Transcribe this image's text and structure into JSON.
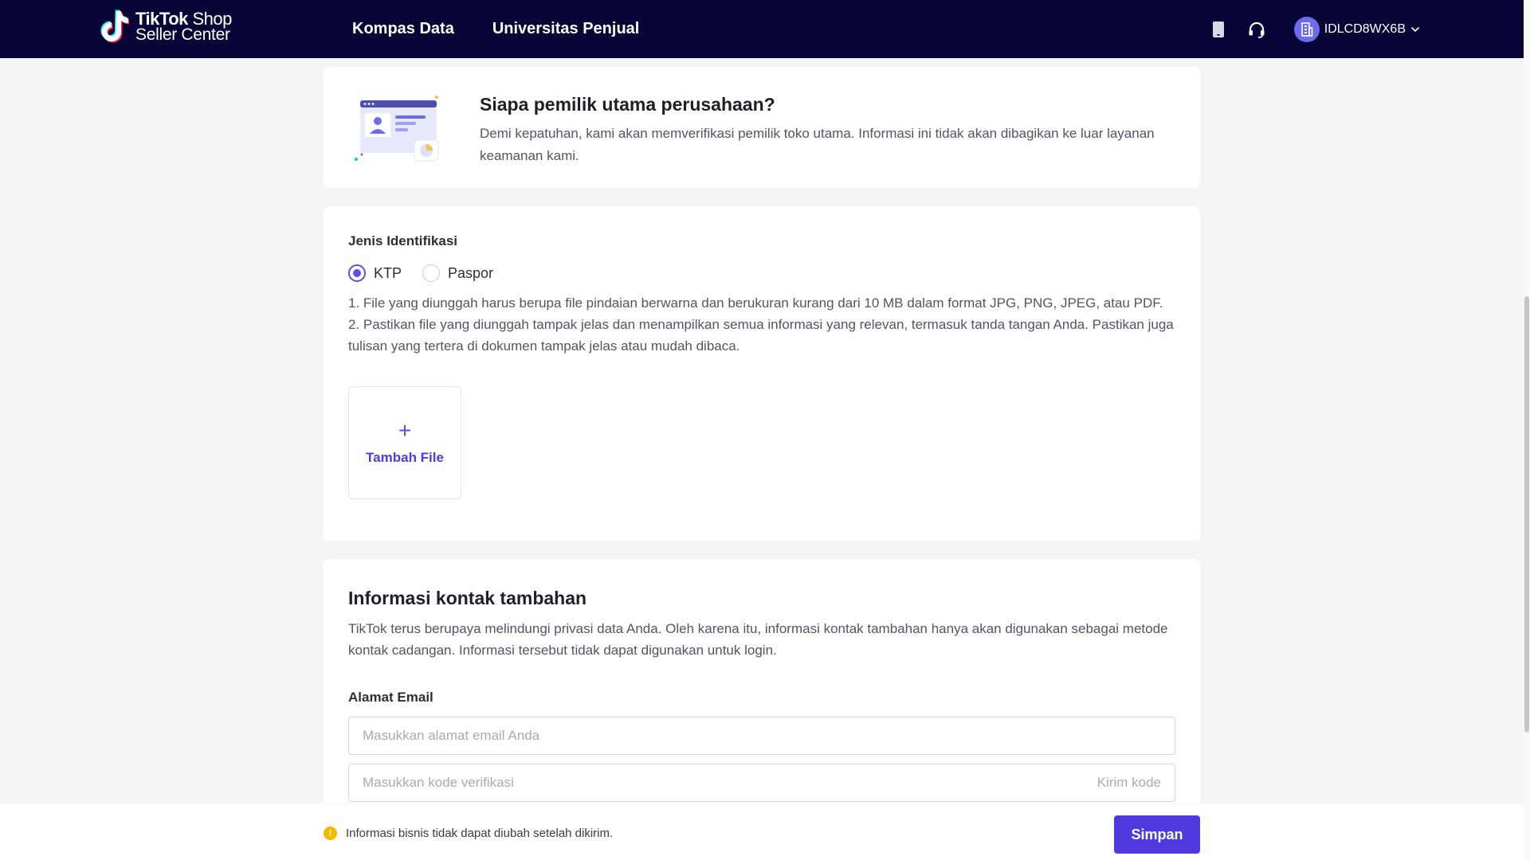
{
  "header": {
    "logo_line1_bold": "TikTok",
    "logo_line1_rest": " Shop",
    "logo_line2": "Seller Center",
    "nav": [
      "Kompas Data",
      "Universitas Penjual"
    ],
    "account_id": "IDLCD8WX6B"
  },
  "owner_section": {
    "title": "Siapa pemilik utama perusahaan?",
    "description": "Demi kepatuhan, kami akan memverifikasi pemilik toko utama. Informasi ini tidak akan dibagikan ke luar layanan keamanan kami."
  },
  "id_section": {
    "label": "Jenis Identifikasi",
    "options": [
      "KTP",
      "Paspor"
    ],
    "selected": "KTP",
    "rule1": "1. File yang diunggah harus berupa file pindaian berwarna dan berukuran kurang dari 10 MB dalam format JPG, PNG, JPEG, atau PDF.",
    "rule2": "2. Pastikan file yang diunggah tampak jelas dan menampilkan semua informasi yang relevan, termasuk tanda tangan Anda. Pastikan juga tulisan yang tertera di dokumen tampak jelas atau mudah dibaca.",
    "upload_label": "Tambah File"
  },
  "contact_section": {
    "title": "Informasi kontak tambahan",
    "description": "TikTok terus berupaya melindungi privasi data Anda. Oleh karena itu, informasi kontak tambahan hanya akan digunakan sebagai metode kontak cadangan. Informasi tersebut tidak dapat digunakan untuk login.",
    "email_label": "Alamat Email",
    "email_value": "",
    "email_placeholder": "Masukkan alamat email Anda",
    "code_value": "",
    "code_placeholder": "Masukkan kode verifikasi",
    "send_code": "Kirim kode"
  },
  "footer": {
    "warning": "Informasi bisnis tidak dapat diubah setelah dikirim.",
    "save_label": "Simpan"
  },
  "colors": {
    "topbar": "#070536",
    "accent": "#4f3ae0",
    "warning": "#f5b700"
  },
  "icons": [
    "tiktok-logo-icon",
    "mobile-phone-icon",
    "headset-icon",
    "building-icon",
    "chevron-down-icon",
    "plus-icon",
    "warning-icon"
  ]
}
